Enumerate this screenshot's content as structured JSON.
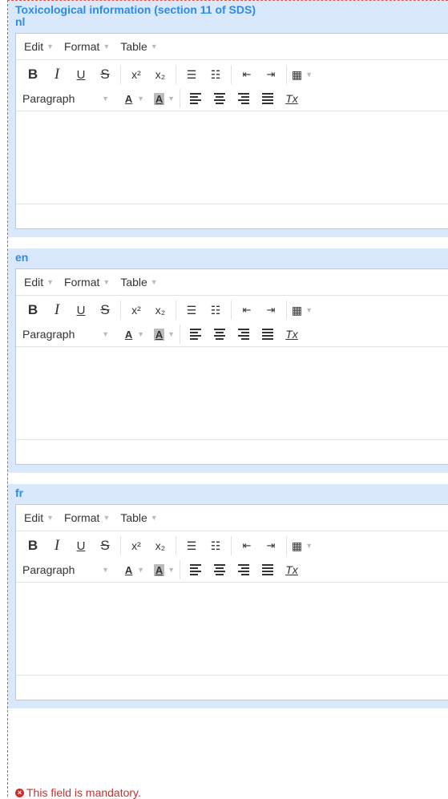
{
  "section_title": "Toxicological information (section 11 of SDS)",
  "menus": {
    "edit": "Edit",
    "format": "Format",
    "table": "Table"
  },
  "toolbar": {
    "bold": "B",
    "italic": "I",
    "underline": "U",
    "strike": "S",
    "superscript": "x²",
    "subscript": "x₂",
    "block_format": "Paragraph",
    "text_color_glyph": "A",
    "bg_color_glyph": "A",
    "clear_format": "Tx"
  },
  "editors": [
    {
      "lang": "nl",
      "content": ""
    },
    {
      "lang": "en",
      "content": ""
    },
    {
      "lang": "fr",
      "content": ""
    }
  ],
  "error": {
    "message": "This field is mandatory."
  },
  "colors": {
    "accent": "#2e8ae6",
    "block_bg": "#d9e9fb",
    "error": "#c9302c"
  }
}
